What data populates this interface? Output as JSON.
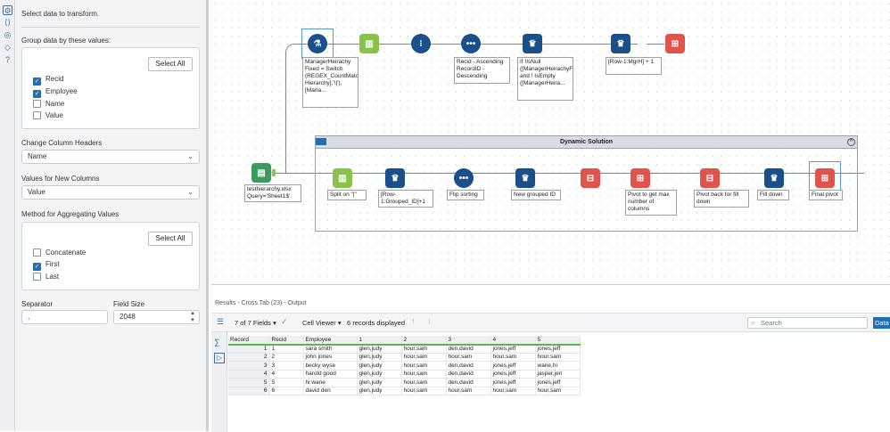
{
  "config": {
    "instruction": "Select data to transform.",
    "group_heading": "Group data by these values:",
    "select_all": "Select All",
    "group_fields": [
      {
        "label": "Recid",
        "checked": true
      },
      {
        "label": "Employee",
        "checked": true
      },
      {
        "label": "Name",
        "checked": false
      },
      {
        "label": "Value",
        "checked": false
      }
    ],
    "change_headers_heading": "Change Column Headers",
    "change_headers_value": "Name",
    "new_columns_heading": "Values for New Columns",
    "new_columns_value": "Value",
    "aggregate_heading": "Method for Aggregating Values",
    "aggregate_methods": [
      {
        "label": "Concatenate",
        "checked": false
      },
      {
        "label": "First",
        "checked": true
      },
      {
        "label": "Last",
        "checked": false
      }
    ],
    "separator_label": "Separator",
    "separator_value": ",",
    "field_size_label": "Field Size",
    "field_size_value": "2048"
  },
  "canvas": {
    "container_title": "Dynamic Solution",
    "input_label": "testhierarchy.xlsx Query='Sheet1$'",
    "top_labels": {
      "formula": "ManagerHeirachy Fixed = Switch (REGEX_CountMatches([Manager Hierarchy],'\\|'), [Mana...",
      "sort": "Recid - Ascending RecordID - Descending",
      "formula2": "If !IsNull ([ManagerHeirachyFixed]) and ! IsEmpty ([ManagerHeira...",
      "multirow": "[Row-1:MgrH] + 1"
    },
    "bottom_labels": {
      "split": "Split on \"|\"",
      "multirow": "[Row-1:Grouped_ID]+1",
      "flip": "Flip sorting",
      "newgroup": "New grouped ID",
      "pivot_max": "Pivot to get max number of columns",
      "pivot_back": "Pivot back for fill down",
      "filldown": "Fill down",
      "final": "Final pivot"
    }
  },
  "results": {
    "title": "Results - Cross Tab (23) - Output",
    "fields": "7 of 7 Fields",
    "viewer": "Cell Viewer",
    "records": "6 records displayed",
    "search_placeholder": "Search",
    "data_button": "Data",
    "columns": [
      "Record",
      "Recid",
      "Employee",
      "1",
      "2",
      "3",
      "4",
      "5"
    ],
    "rows": [
      [
        "1",
        "1",
        "sara smith",
        "glen,judy",
        "hour,sam",
        "den,david",
        "jones,jeff",
        "jones,jeff"
      ],
      [
        "2",
        "2",
        "john jones",
        "glen,judy",
        "hour,sam",
        "hour,sam",
        "hour,sam",
        "hour,sam"
      ],
      [
        "3",
        "3",
        "becky wyse",
        "glen,judy",
        "hour,sam",
        "den,david",
        "jones,jeff",
        "wane,hi"
      ],
      [
        "4",
        "4",
        "harold good",
        "glen,judy",
        "hour,sam",
        "den,david",
        "jones,jeff",
        "jasper,jen"
      ],
      [
        "5",
        "5",
        "hi wane",
        "glen,judy",
        "hour,sam",
        "den,david",
        "jones,jeff",
        "jones,jeff"
      ],
      [
        "6",
        "6",
        "david den",
        "glen,judy",
        "hour,sam",
        "hour,sam",
        "hour,sam",
        "hour,sam"
      ]
    ]
  },
  "colors": {
    "accent": "#1f6fb5",
    "formula_tool": "#1b4f8a",
    "text_tool": "#8bc34a",
    "transform_tool": "#e0544c",
    "input_tool": "#3a9b5c"
  }
}
